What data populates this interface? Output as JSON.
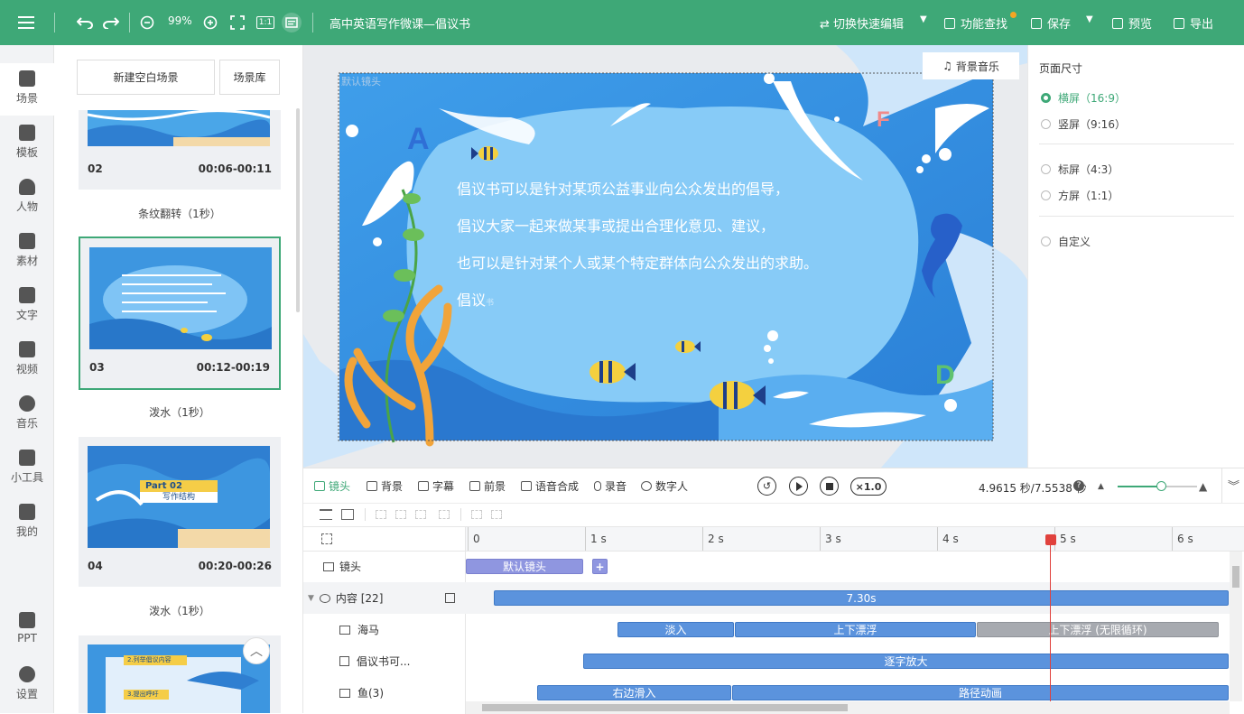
{
  "topbar": {
    "zoom": "99%",
    "title": "高中英语写作微课—倡议书",
    "switch_edit": "切换快速编辑",
    "func_search": "功能查找",
    "save": "保存",
    "preview": "预览",
    "export": "导出",
    "ratio_icon": "1:1",
    "icons": [
      "menu-icon",
      "undo-icon",
      "redo-icon",
      "zoom-out-icon",
      "zoom-in-icon",
      "fullscreen-icon",
      "ratio-icon",
      "subtitle-icon",
      "search-icon",
      "save-icon",
      "preview-icon",
      "export-icon"
    ],
    "accent": "#3ea877",
    "badge_color": "#f5a623"
  },
  "leftnav": [
    {
      "label": "场景",
      "icon": "scene-icon",
      "active": true
    },
    {
      "label": "模板",
      "icon": "template-icon"
    },
    {
      "label": "人物",
      "icon": "person-icon"
    },
    {
      "label": "素材",
      "icon": "material-icon"
    },
    {
      "label": "文字",
      "icon": "text-icon"
    },
    {
      "label": "视频",
      "icon": "video-icon"
    },
    {
      "label": "音乐",
      "icon": "music-icon"
    },
    {
      "label": "小工具",
      "icon": "toolbox-icon"
    },
    {
      "label": "我的",
      "icon": "my-icon"
    },
    {
      "label": "PPT",
      "icon": "ppt-icon"
    },
    {
      "label": "设置",
      "icon": "settings-icon"
    }
  ],
  "scenes": {
    "new_blank": "新建空白场景",
    "library": "场景库",
    "items": [
      {
        "num": "02",
        "time": "00:06-00:11",
        "transition": "条纹翻转（1秒）"
      },
      {
        "num": "03",
        "time": "00:12-00:19",
        "transition": "泼水（1秒）",
        "selected": true
      },
      {
        "num": "04",
        "time": "00:20-00:26",
        "transition": "泼水（1秒）",
        "part_title": "Part 02",
        "part_sub": "写作结构"
      },
      {
        "thumb_line1": "2.列举倡议内容",
        "thumb_line2": "3.提出呼吁"
      }
    ]
  },
  "canvas": {
    "camera_label": "默认镜头",
    "bg_music": "背景音乐",
    "lines": [
      "倡议书可以是针对某项公益事业向公众发出的倡导，",
      "倡议大家一起来做某事或提出合理化意见、建议，",
      "也可以是针对某个人或某个特定群体向公众发出的求助。"
    ],
    "partial_line_big": "倡议",
    "partial_line_small": "书",
    "letters": [
      "A",
      "F",
      "D"
    ]
  },
  "rpanel": {
    "title": "页面尺寸",
    "options": [
      {
        "label": "横屏（16:9）",
        "checked": true
      },
      {
        "label": "竖屏（9:16）"
      },
      {
        "label": "标屏（4:3）"
      },
      {
        "label": "方屏（1:1）"
      },
      {
        "label": "自定义"
      }
    ]
  },
  "timeline": {
    "tabs": [
      "镜头",
      "背景",
      "字幕",
      "前景",
      "语音合成",
      "录音",
      "数字人"
    ],
    "speed": "×1.0",
    "time": "4.9615 秒/7.5538 秒",
    "zoom_fraction": 0.55,
    "ruler": [
      "0",
      "1 s",
      "2 s",
      "3 s",
      "4 s",
      "5 s",
      "6 s"
    ],
    "playhead_s": 4.9615,
    "tracks": [
      {
        "label": "镜头"
      },
      {
        "label": "内容 [22]"
      },
      {
        "label": "海马"
      },
      {
        "label": "倡议书可..."
      },
      {
        "label": "鱼(3)"
      }
    ],
    "clips": {
      "camera": "默认镜头",
      "add": "+",
      "content": "7.30s",
      "seahorse": [
        "淡入",
        "上下漂浮",
        "上下漂浮 (无限循环)"
      ],
      "text": "逐字放大",
      "fish": [
        "右边滑入",
        "路径动画"
      ]
    }
  }
}
